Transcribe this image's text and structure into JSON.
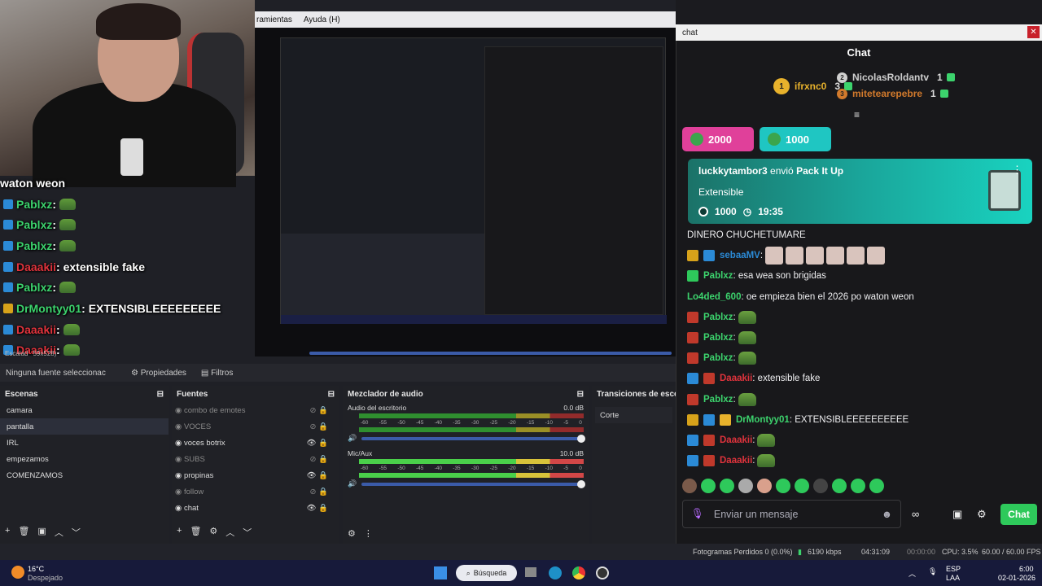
{
  "menubar": {
    "items": [
      "ramientas",
      "Ayuda (H)"
    ]
  },
  "overlay_chat": [
    {
      "text": "waton weon",
      "color": "#ffffff",
      "badge": "",
      "emote": false
    },
    {
      "text": "Pablxz",
      "color": "#3cd36d",
      "badge": "#2b8ad6",
      "emote": true,
      "sep": " :"
    },
    {
      "text": "Pablxz",
      "color": "#3cd36d",
      "badge": "#2b8ad6",
      "emote": true,
      "sep": " :"
    },
    {
      "text": "Pablxz",
      "color": "#3cd36d",
      "badge": "#2b8ad6",
      "emote": true,
      "sep": " :"
    },
    {
      "text": "Daaakii",
      "color": "#e0333c",
      "badge": "#2b8ad6",
      "emote": false,
      "sep": " : extensible fake"
    },
    {
      "text": "Pablxz",
      "color": "#3cd36d",
      "badge": "#2b8ad6",
      "emote": true,
      "sep": " :"
    },
    {
      "text": "DrMontyy01",
      "color": "#3cd36d",
      "badge": "#d7a21a",
      "emote": false,
      "sep": " : EXTENSIBLEEEEEEEEE"
    },
    {
      "text": "Daaakii",
      "color": "#e0333c",
      "badge": "#2b8ad6",
      "emote": true,
      "sep": " :"
    },
    {
      "text": "Daaakii",
      "color": "#e0333c",
      "badge": "#2b8ad6",
      "emote": true,
      "sep": " :"
    }
  ],
  "obs_toolbar": {
    "no_source": "Ninguna fuente seleccionac",
    "properties": "Propiedades",
    "filters": "Filtros"
  },
  "scenes": {
    "title": "Escenas",
    "items": [
      "camara",
      "pantalla",
      "IRL",
      "empezamos",
      "COMENZAMOS"
    ],
    "selected": 1
  },
  "sources": {
    "title": "Fuentes",
    "items": [
      {
        "name": "combo de emotes",
        "visible": false
      },
      {
        "name": "VOCES",
        "visible": false
      },
      {
        "name": "voces botrix",
        "visible": true
      },
      {
        "name": "SUBS",
        "visible": false
      },
      {
        "name": "propinas",
        "visible": true
      },
      {
        "name": "follow",
        "visible": false
      },
      {
        "name": "chat",
        "visible": true
      }
    ]
  },
  "mixer": {
    "title": "Mezclador de audio",
    "channels": [
      {
        "name": "Audio del escritorio",
        "db": "0.0 dB"
      },
      {
        "name": "Mic/Aux",
        "db": "10.0 dB"
      }
    ],
    "ticks": [
      "-60",
      "-55",
      "-50",
      "-45",
      "-40",
      "-35",
      "-30",
      "-25",
      "-20",
      "-15",
      "-10",
      "-5",
      "0"
    ]
  },
  "transitions": {
    "title": "Transiciones de escena",
    "value": "Corte"
  },
  "chat_window": {
    "titlebar": "chat",
    "header": "Chat",
    "leaderboard": [
      {
        "rank": "1",
        "name": "ifrxnc0",
        "count": "3",
        "color": "#e8b22c"
      },
      {
        "rank": "2",
        "name": "NicolasRoldantv",
        "count": "1",
        "color": "#cfcfcf"
      },
      {
        "rank": "3",
        "name": "mitetearepebre",
        "count": "1",
        "color": "#d27a2c"
      }
    ],
    "pills": [
      {
        "value": "2000",
        "color": "#e0409a"
      },
      {
        "value": "1000",
        "color": "#1fc6c2"
      }
    ],
    "notification": {
      "user": "luckkytambor3",
      "action": "envió",
      "item": "Pack It Up",
      "subtitle": "Extensible",
      "amount": "1000",
      "time": "19:35"
    },
    "messages": [
      {
        "user": "",
        "text": "DINERO CHUCHETUMARE",
        "color": "#efeff1",
        "badges": [],
        "emotes": 0,
        "faces": 0
      },
      {
        "user": "sebaaMV",
        "text": ":",
        "color": "#2b8ad6",
        "badges": [
          "#d7a21a",
          "#2b8ad6"
        ],
        "emotes": 0,
        "faces": 6
      },
      {
        "user": "Pablxz",
        "text": ": esa wea son brigidas",
        "color": "#3cd36d",
        "badges": [
          "#2ec95b"
        ],
        "emotes": 0,
        "faces": 0
      },
      {
        "user": "Lo4ded_600",
        "text": ": oe empieza bien el 2026 po waton weon",
        "color": "#3cd36d",
        "badges": [],
        "emotes": 0,
        "faces": 0
      },
      {
        "user": "Pablxz",
        "text": ":",
        "color": "#3cd36d",
        "badges": [
          "#c0392b"
        ],
        "emotes": 1,
        "faces": 0
      },
      {
        "user": "Pablxz",
        "text": ":",
        "color": "#3cd36d",
        "badges": [
          "#c0392b"
        ],
        "emotes": 1,
        "faces": 0
      },
      {
        "user": "Pablxz",
        "text": ":",
        "color": "#3cd36d",
        "badges": [
          "#c0392b"
        ],
        "emotes": 1,
        "faces": 0
      },
      {
        "user": "Daaakii",
        "text": ": extensible fake",
        "color": "#e0333c",
        "badges": [
          "#2b8ad6",
          "#c0392b"
        ],
        "emotes": 0,
        "faces": 0
      },
      {
        "user": "Pablxz",
        "text": ":",
        "color": "#3cd36d",
        "badges": [
          "#c0392b"
        ],
        "emotes": 1,
        "faces": 0
      },
      {
        "user": "DrMontyy01",
        "text": ": EXTENSIBLEEEEEEEEEE",
        "color": "#3cd36d",
        "badges": [
          "#d7a21a",
          "#2b8ad6",
          "#e8b22c"
        ],
        "emotes": 0,
        "faces": 0
      },
      {
        "user": "Daaakii",
        "text": ":",
        "color": "#e0333c",
        "badges": [
          "#2b8ad6",
          "#c0392b"
        ],
        "emotes": 1,
        "faces": 0
      },
      {
        "user": "Daaakii",
        "text": ":",
        "color": "#e0333c",
        "badges": [
          "#2b8ad6",
          "#c0392b"
        ],
        "emotes": 1,
        "faces": 0
      }
    ],
    "input_placeholder": "Enviar un mensaje",
    "send_label": "Chat",
    "emote_colors": [
      "#7a5a4a",
      "#2ec95b",
      "#2ec95b",
      "#aaaaaa",
      "#d9a08c",
      "#2ec95b",
      "#2ec95b",
      "#444444",
      "#2ec95b",
      "#2ec95b",
      "#2ec95b"
    ]
  },
  "statusbar": {
    "dropped": "Fotogramas Perdidos 0 (0.0%)",
    "kbps": "6190 kbps",
    "stream_time": "04:31:09",
    "rec_time": "00:00:00",
    "cpu": "CPU: 3.5%",
    "fps": "60.00 / 60.00 FPS"
  },
  "taskbar": {
    "temp": "16°C",
    "weather": "Despejado",
    "search": "Búsqueda",
    "lang1": "ESP",
    "lang2": "LAA",
    "time": "6:00",
    "date": "02-01-2026"
  },
  "preview_status": {
    "text": "Escalad",
    "res": "59x528)"
  }
}
